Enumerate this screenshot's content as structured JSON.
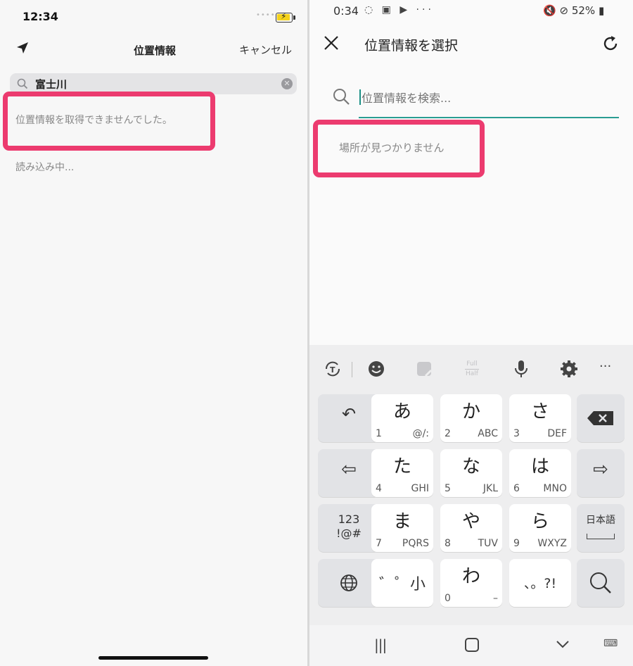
{
  "ios": {
    "time": "12:34",
    "signal_dots": "••••",
    "title": "位置情報",
    "cancel_label": "キャンセル",
    "search_value": "富士川",
    "error_message": "位置情報を取得できませんでした。",
    "loading_message": "読み込み中..."
  },
  "android": {
    "time": "0:34",
    "status_icons": "◌ ▣ ▶ ···",
    "battery_text": "52%",
    "title": "位置情報を選択",
    "search_placeholder": "位置情報を検索...",
    "empty_message": "場所が見つかりません",
    "keyboard": {
      "toolbar": [
        "text-convert-icon",
        "emoji-icon",
        "sticker-icon",
        "full-half-icon",
        "microphone-icon",
        "settings-icon",
        "more-icon"
      ],
      "full_label": "Full",
      "half_label": "Half",
      "keys": {
        "a": {
          "big": "あ",
          "num": "1",
          "sub": "@/:"
        },
        "ka": {
          "big": "か",
          "num": "2",
          "sub": "ABC"
        },
        "sa": {
          "big": "さ",
          "num": "3",
          "sub": "DEF"
        },
        "ta": {
          "big": "た",
          "num": "4",
          "sub": "GHI"
        },
        "na": {
          "big": "な",
          "num": "5",
          "sub": "JKL"
        },
        "ha": {
          "big": "は",
          "num": "6",
          "sub": "MNO"
        },
        "ma": {
          "big": "ま",
          "num": "7",
          "sub": "PQRS"
        },
        "ya": {
          "big": "や",
          "num": "8",
          "sub": "TUV"
        },
        "ra": {
          "big": "ら",
          "num": "9",
          "sub": "WXYZ"
        },
        "dakuten": {
          "big": "゛゜小"
        },
        "wa": {
          "big": "わ",
          "num": "0",
          "sub": "–"
        },
        "punct": {
          "big": "、。?!"
        },
        "numbers": "123\n!@#",
        "nihongo": "日本語"
      }
    },
    "accent_color": "#2a9d92",
    "highlight_color": "#ec3b6f"
  }
}
